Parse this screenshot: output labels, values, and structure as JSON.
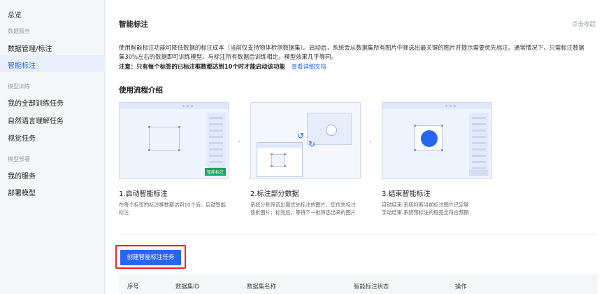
{
  "sidebar": {
    "overview": "总览",
    "group_data": "数据服务",
    "data_mgmt": "数据管理/标注",
    "smart_label": "智能标注",
    "group_train": "模型训练",
    "all_train": "我的全部训练任务",
    "nlu": "自然语言理解任务",
    "vision": "视觉任务",
    "group_deploy": "模型部署",
    "my_service": "我的服务",
    "deploy_model": "部署模型"
  },
  "header": {
    "title": "智能标注",
    "collapse": "点击收起"
  },
  "description": {
    "line1": "使用智能标注功能可降低数据的标注成本（当前仅支持物体检测数据集）。启动后，系统会从数据集所有图片中筛选出最关键的图片并提示需要优先标注。通常情况下，只需标注数据",
    "line2": "集30%左右的数据即可训练模型。与标注所有数据后训练相比，模型效果几乎等同。",
    "note": "注意：只有每个标签的已标注框数都达到10个时才能启动该功能",
    "note_link": "查看详细文档"
  },
  "workflow": {
    "title": "使用流程介绍",
    "tag_label": "智能标注",
    "steps": [
      {
        "title": "1.启动智能标注",
        "desc1": "在每个标签的标注框数都达到10个后，启动智能",
        "desc2": "标注"
      },
      {
        "title": "2.标注部分数据",
        "desc1": "系统分批筛选出需优先标注的图片，您优先标注",
        "desc2": "该批图片；标完后，等待下一批筛选出来的图片"
      },
      {
        "title": "3.结束智能标注",
        "desc1": "自动结束:系统判断当前标注图片已足够",
        "desc2": "手动结束:系统预标注的框完全符合预期"
      }
    ]
  },
  "actions": {
    "create": "创建智能标注任务"
  },
  "table": {
    "columns": [
      "序号",
      "数据集ID",
      "数据集名称",
      "智能标注状态",
      "操作"
    ]
  },
  "colors": {
    "accent": "#2468f2",
    "highlight_box": "#e8262b",
    "tag_green": "#1aa260"
  }
}
